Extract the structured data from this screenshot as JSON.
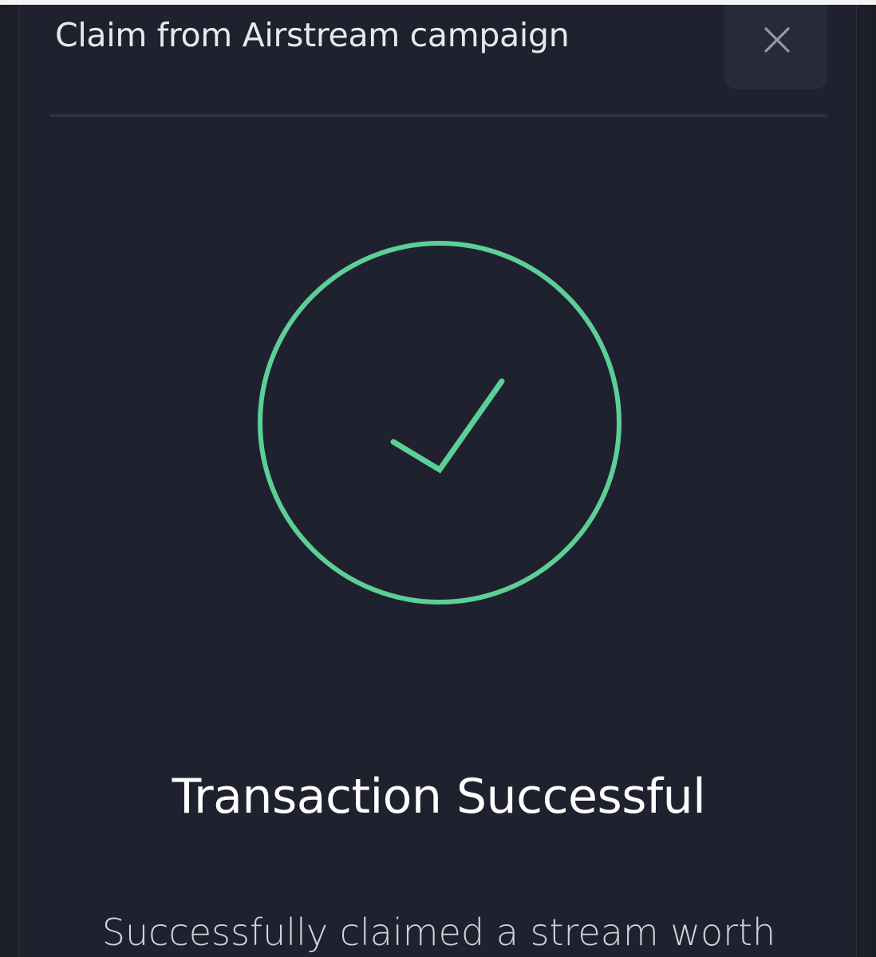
{
  "modal": {
    "title": "Claim from Airstream campaign",
    "close_icon": "close-icon"
  },
  "status": {
    "icon": "check-circle-icon",
    "icon_color": "#5ccf96",
    "title": "Transaction Successful",
    "message": "Successfully claimed a stream worth"
  },
  "colors": {
    "background": "#1a1c25",
    "modal": "#1f212e",
    "close_button_bg": "#272a37",
    "divider": "#2e3142",
    "title_text": "#e8e9ee",
    "accent_success": "#5ccf96"
  }
}
